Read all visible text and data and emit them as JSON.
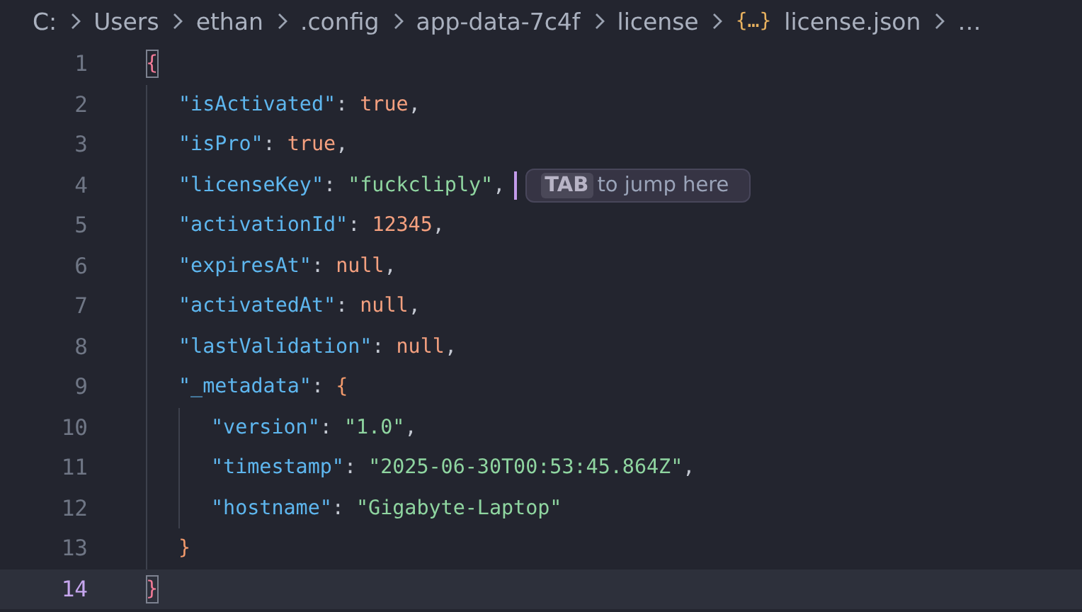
{
  "breadcrumb": [
    {
      "text": "C:"
    },
    {
      "text": "Users"
    },
    {
      "text": "ethan"
    },
    {
      "text": ".config"
    },
    {
      "text": "app-data-7c4f"
    },
    {
      "text": "license"
    },
    {
      "text": "license.json",
      "icon": "{…}"
    },
    {
      "text": "…"
    }
  ],
  "lines": [
    {
      "number": "1",
      "selected": false,
      "tokens": [
        {
          "kind": "brace-outer",
          "text": "{",
          "match": true
        }
      ],
      "children": [
        {
          "number": "2",
          "selected": false,
          "tokens": [
            {
              "kind": "key",
              "text": "\"isActivated\""
            },
            {
              "kind": "punct",
              "text": ": "
            },
            {
              "kind": "literal",
              "text": "true"
            },
            {
              "kind": "punct",
              "text": ","
            }
          ]
        },
        {
          "number": "3",
          "selected": false,
          "tokens": [
            {
              "kind": "key",
              "text": "\"isPro\""
            },
            {
              "kind": "punct",
              "text": ": "
            },
            {
              "kind": "literal",
              "text": "true"
            },
            {
              "kind": "punct",
              "text": ","
            }
          ]
        },
        {
          "number": "4",
          "selected": false,
          "tokens": [
            {
              "kind": "key",
              "text": "\"licenseKey\""
            },
            {
              "kind": "punct",
              "text": ": "
            },
            {
              "kind": "string",
              "text": "\"fuckcliply\""
            },
            {
              "kind": "punct",
              "text": ","
            }
          ],
          "cursor": true,
          "hint": {
            "key": "TAB",
            "text": "to jump here"
          }
        },
        {
          "number": "5",
          "selected": false,
          "tokens": [
            {
              "kind": "key",
              "text": "\"activationId\""
            },
            {
              "kind": "punct",
              "text": ": "
            },
            {
              "kind": "literal",
              "text": "12345"
            },
            {
              "kind": "punct",
              "text": ","
            }
          ]
        },
        {
          "number": "6",
          "selected": false,
          "tokens": [
            {
              "kind": "key",
              "text": "\"expiresAt\""
            },
            {
              "kind": "punct",
              "text": ": "
            },
            {
              "kind": "literal",
              "text": "null"
            },
            {
              "kind": "punct",
              "text": ","
            }
          ]
        },
        {
          "number": "7",
          "selected": false,
          "tokens": [
            {
              "kind": "key",
              "text": "\"activatedAt\""
            },
            {
              "kind": "punct",
              "text": ": "
            },
            {
              "kind": "literal",
              "text": "null"
            },
            {
              "kind": "punct",
              "text": ","
            }
          ]
        },
        {
          "number": "8",
          "selected": false,
          "tokens": [
            {
              "kind": "key",
              "text": "\"lastValidation\""
            },
            {
              "kind": "punct",
              "text": ": "
            },
            {
              "kind": "literal",
              "text": "null"
            },
            {
              "kind": "punct",
              "text": ","
            }
          ]
        },
        {
          "number": "9",
          "selected": false,
          "tokens": [
            {
              "kind": "key",
              "text": "\"_metadata\""
            },
            {
              "kind": "punct",
              "text": ": "
            },
            {
              "kind": "brace-inner",
              "text": "{",
              "match": false
            }
          ],
          "children": [
            {
              "number": "10",
              "selected": false,
              "tokens": [
                {
                  "kind": "key",
                  "text": "\"version\""
                },
                {
                  "kind": "punct",
                  "text": ": "
                },
                {
                  "kind": "string",
                  "text": "\"1.0\""
                },
                {
                  "kind": "punct",
                  "text": ","
                }
              ]
            },
            {
              "number": "11",
              "selected": false,
              "tokens": [
                {
                  "kind": "key",
                  "text": "\"timestamp\""
                },
                {
                  "kind": "punct",
                  "text": ": "
                },
                {
                  "kind": "string",
                  "text": "\"2025-06-30T00:53:45.864Z\""
                },
                {
                  "kind": "punct",
                  "text": ","
                }
              ]
            },
            {
              "number": "12",
              "selected": false,
              "tokens": [
                {
                  "kind": "key",
                  "text": "\"hostname\""
                },
                {
                  "kind": "punct",
                  "text": ": "
                },
                {
                  "kind": "string",
                  "text": "\"Gigabyte-Laptop\""
                }
              ]
            }
          ]
        },
        {
          "number": "13",
          "selected": false,
          "tokens": [
            {
              "kind": "brace-inner",
              "text": "}",
              "match": false
            }
          ]
        }
      ]
    },
    {
      "number": "14",
      "selected": true,
      "tokens": [
        {
          "kind": "brace-outer",
          "text": "}",
          "match": true
        }
      ]
    }
  ]
}
